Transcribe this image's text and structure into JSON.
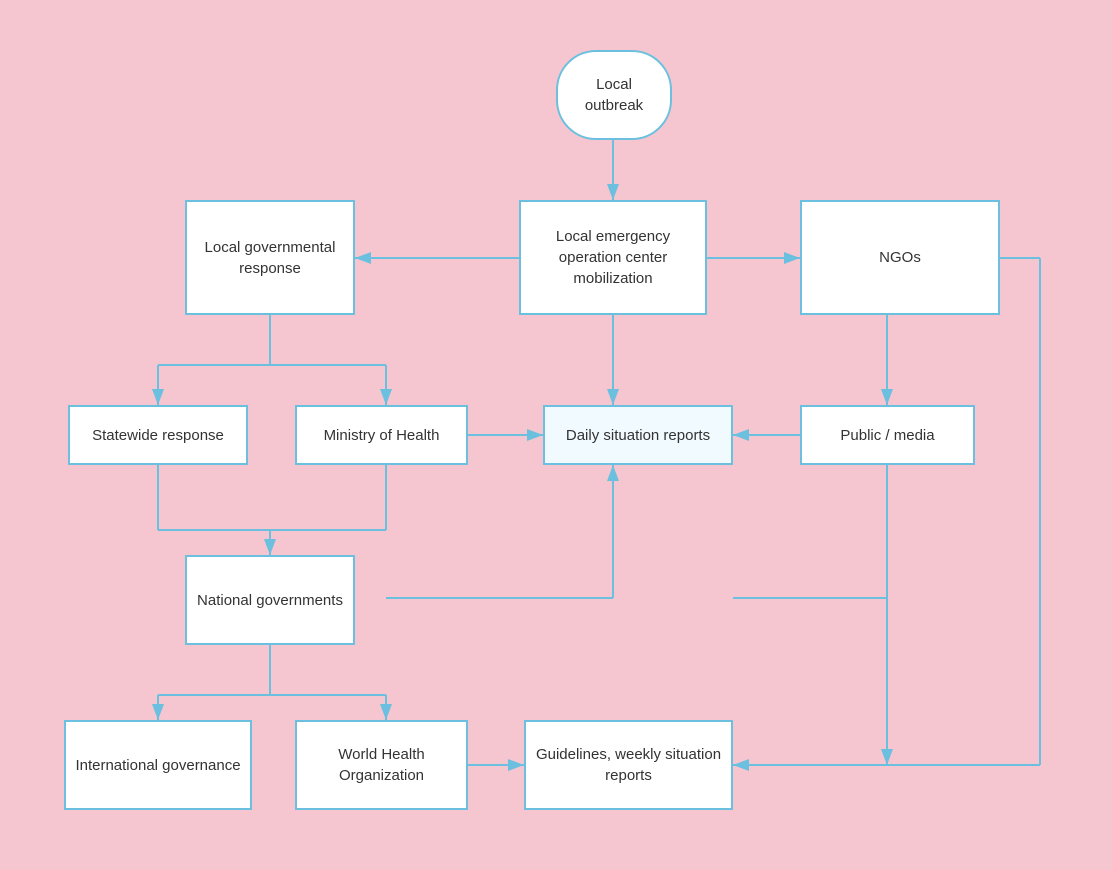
{
  "nodes": {
    "local_outbreak": {
      "label": "Local\noutbreak"
    },
    "local_emergency": {
      "label": "Local emergency\noperation center\nmobilization"
    },
    "local_gov": {
      "label": "Local\ngovernmental\nresponse"
    },
    "ngos": {
      "label": "NGOs"
    },
    "statewide": {
      "label": "Statewide response"
    },
    "ministry": {
      "label": "Ministry of Health"
    },
    "daily_reports": {
      "label": "Daily situation\nreports"
    },
    "public_media": {
      "label": "Public / media"
    },
    "national_gov": {
      "label": "National\ngovernments"
    },
    "intl_gov": {
      "label": "International\ngovernance"
    },
    "who": {
      "label": "World Health\nOrganization"
    },
    "guidelines": {
      "label": "Guidelines, weekly\nsituation reports"
    }
  }
}
